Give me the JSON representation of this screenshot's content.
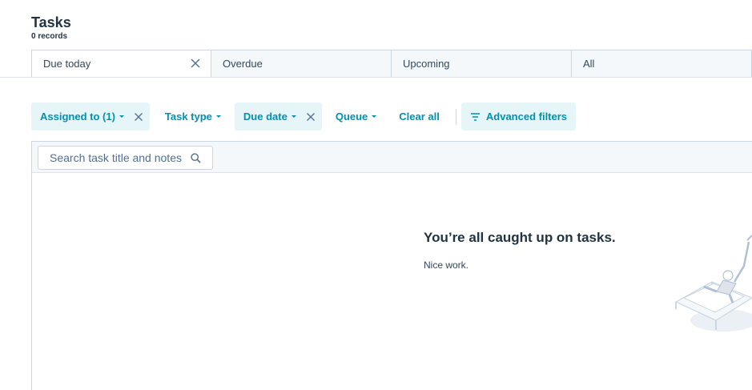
{
  "header": {
    "title": "Tasks",
    "record_count": "0 records"
  },
  "tabs": [
    {
      "label": "Due today",
      "closable": true,
      "active": true
    },
    {
      "label": "Overdue",
      "closable": false,
      "active": false
    },
    {
      "label": "Upcoming",
      "closable": false,
      "active": false
    },
    {
      "label": "All",
      "closable": false,
      "active": false
    }
  ],
  "filters": {
    "assigned_to": "Assigned to (1)",
    "task_type": "Task type",
    "due_date": "Due date",
    "queue": "Queue",
    "clear_all": "Clear all",
    "advanced_filters": "Advanced filters"
  },
  "search": {
    "placeholder": "Search task title and notes"
  },
  "empty_state": {
    "title": "You’re all caught up on tasks.",
    "text": "Nice work."
  },
  "colors": {
    "accent": "#0091ae",
    "filter_active_bg": "#e5f5f8",
    "heading": "#213343",
    "border": "#cbd6e2"
  },
  "icons": {
    "tab_close": "close-icon",
    "filter_close": "close-icon",
    "advanced": "filter-lines-icon",
    "search": "search-icon"
  }
}
